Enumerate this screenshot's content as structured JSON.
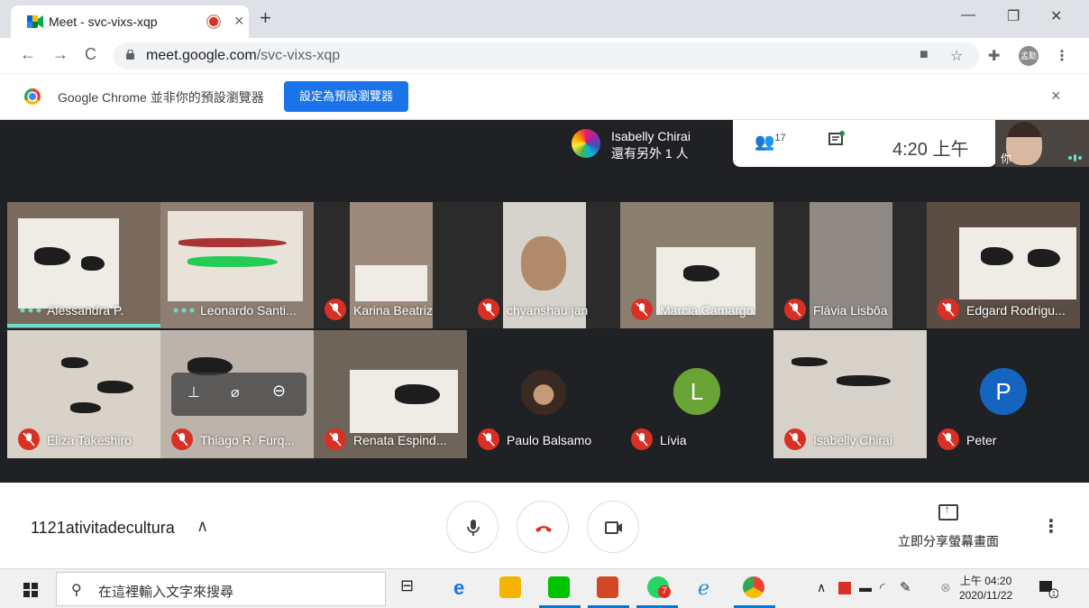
{
  "browser": {
    "tab_title": "Meet - svc-vixs-xqp",
    "tab_close": "×",
    "new_tab": "+",
    "window_controls": [
      "—",
      "❐",
      "✕"
    ],
    "url_domain": "meet.google.com",
    "url_path": "/svc-vixs-xqp",
    "profile_label": "孟勳"
  },
  "infobar": {
    "message": "Google Chrome 並非你的預設瀏覽器",
    "set_default_button": "設定為預設瀏覽器",
    "close": "×"
  },
  "meet": {
    "presenter_name": "Isabelly Chirai",
    "presenter_sub": "還有另外 1 人",
    "people_count": "17",
    "time": "4:20 上午",
    "self_label": "你",
    "meeting_code": "1121ativitadecultura",
    "present_now_label": "立即分享螢幕畫面",
    "participants": [
      {
        "name": "Alessandra P.",
        "muted": false
      },
      {
        "name": "Leonardo Santi...",
        "muted": false
      },
      {
        "name": "Karina Beatriz",
        "muted": true
      },
      {
        "name": "chyanshau jan",
        "muted": true
      },
      {
        "name": "Marcia Camargo",
        "muted": true
      },
      {
        "name": "Flávia Lisbôa",
        "muted": true
      },
      {
        "name": "Edgard Rodrigu...",
        "muted": true
      },
      {
        "name": "Eliza Takeshiro",
        "muted": true
      },
      {
        "name": "Thiago R. Furq...",
        "muted": true
      },
      {
        "name": "Renata Espind...",
        "muted": true
      },
      {
        "name": "Paulo Balsamo",
        "muted": true
      },
      {
        "name": "Lívia",
        "muted": true,
        "initial": "L",
        "color": "#6aa336"
      },
      {
        "name": "Isabelly Chirai",
        "muted": true
      },
      {
        "name": "Peter",
        "muted": true,
        "initial": "P",
        "color": "#1565c0"
      }
    ]
  },
  "taskbar": {
    "search_placeholder": "在這裡輸入文字來搜尋",
    "tray_time": "上午 04:20",
    "tray_date": "2020/11/22",
    "notification_count": "1",
    "whatsapp_badge": "7"
  },
  "colors": {
    "meet_bg": "#202124",
    "mute_red": "#d93025",
    "chrome_blue": "#1a73e8",
    "speaking_teal": "#6fdcc8"
  }
}
